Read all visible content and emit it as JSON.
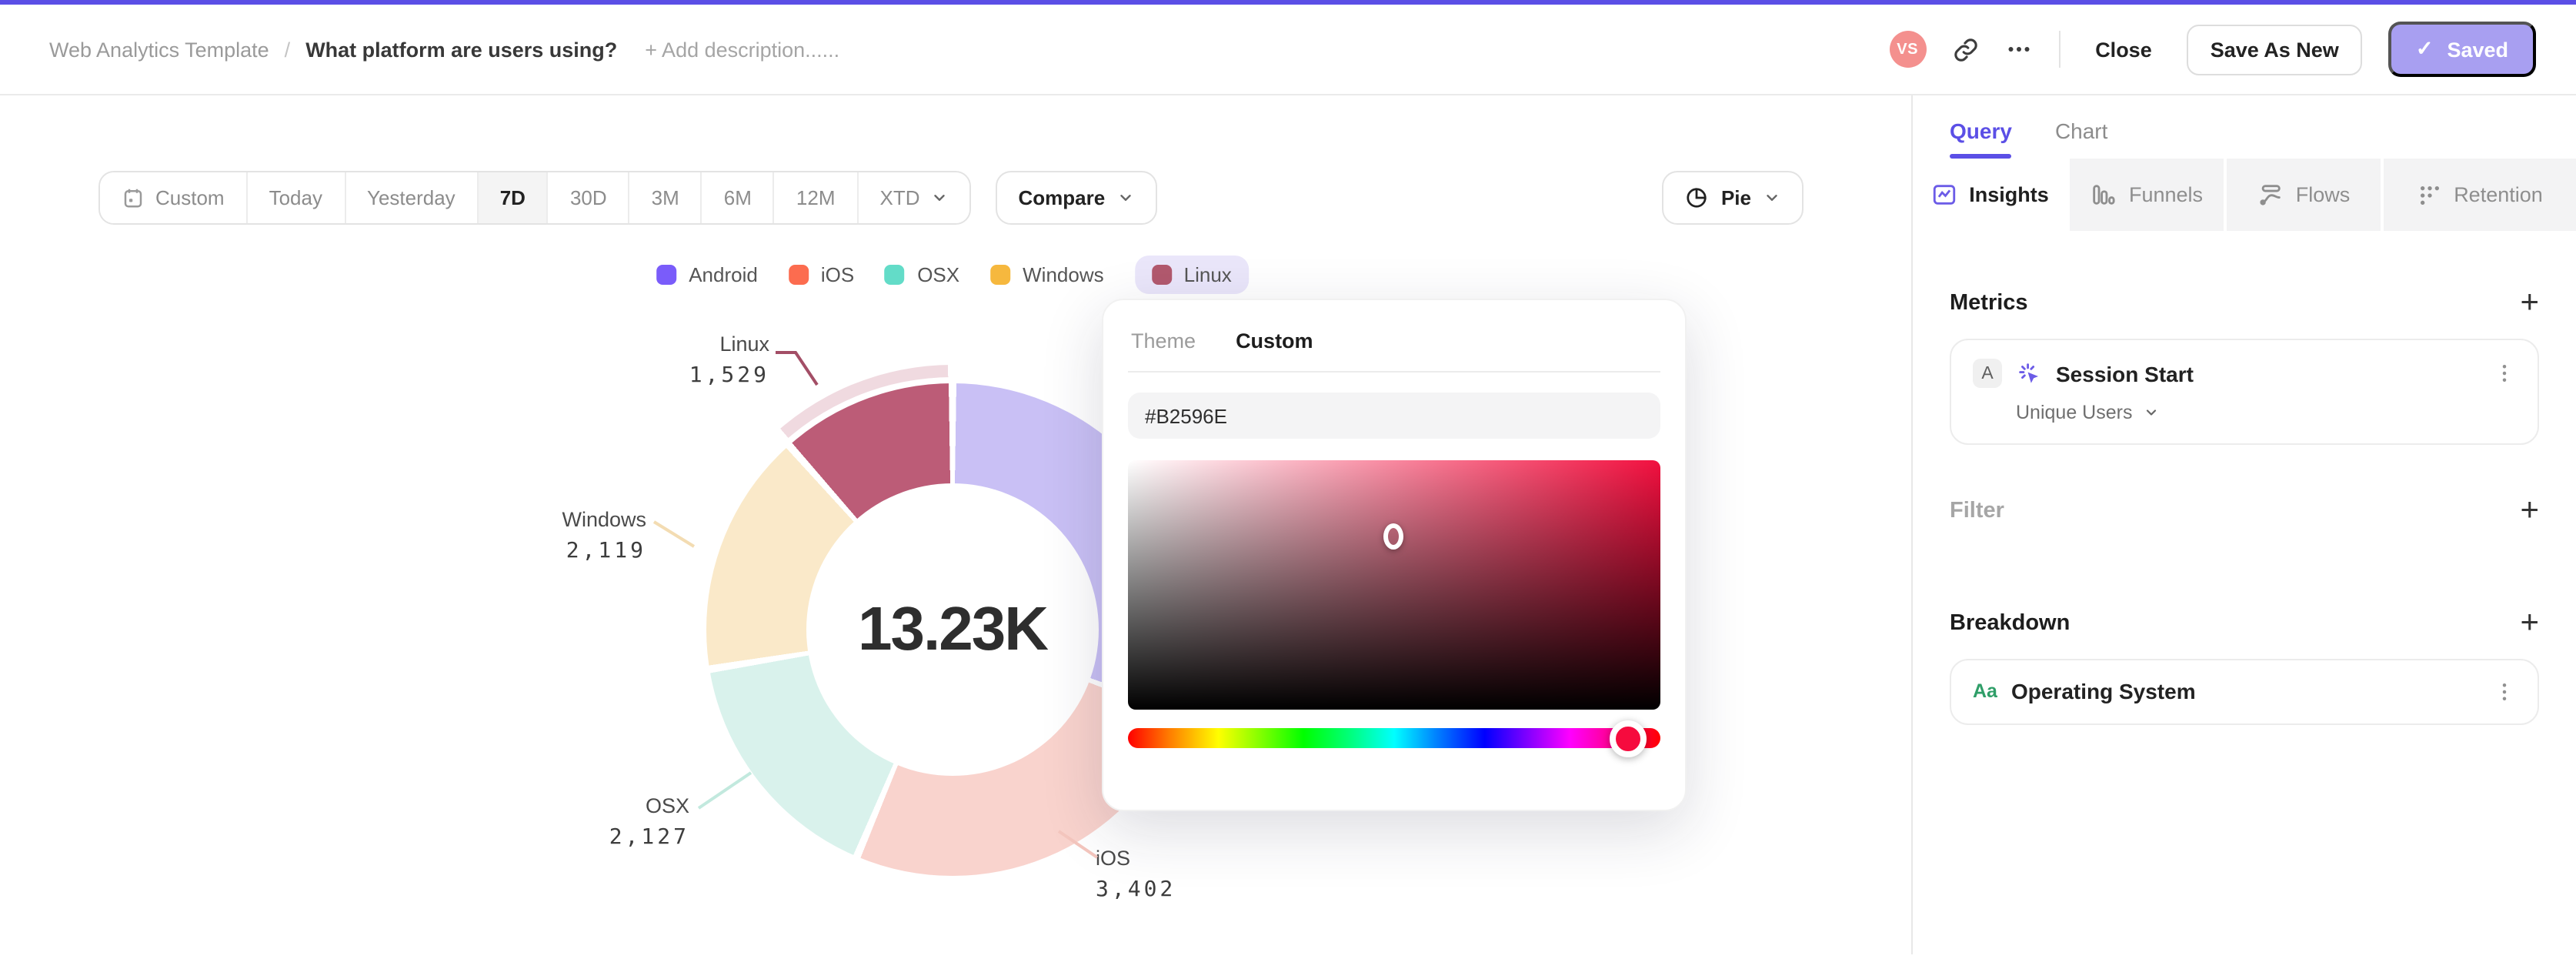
{
  "colors": {
    "accent": "#5B4FE6",
    "saved_button_bg": "#A89FF1",
    "avatar_bg": "#F4908E",
    "legend_pill_bg": "#EAE6FA",
    "picker_hue_color": "#F60B3E"
  },
  "header": {
    "breadcrumb_root": "Web Analytics Template",
    "breadcrumb_sep": "/",
    "title": "What platform are users using?",
    "add_description": "+ Add description......",
    "avatar_initials": "VS",
    "close_label": "Close",
    "save_as_new_label": "Save As New",
    "saved_label": "Saved",
    "saved_check": "✓"
  },
  "toolbar": {
    "date_ranges": [
      {
        "label": "Custom"
      },
      {
        "label": "Today"
      },
      {
        "label": "Yesterday"
      },
      {
        "label": "7D",
        "active": true
      },
      {
        "label": "30D"
      },
      {
        "label": "3M"
      },
      {
        "label": "6M"
      },
      {
        "label": "12M"
      },
      {
        "label": "XTD"
      }
    ],
    "compare_label": "Compare",
    "chart_type_label": "Pie"
  },
  "chart_data": {
    "type": "pie",
    "style": "donut",
    "title": "",
    "center_total": "13.23K",
    "total_value": 13230,
    "categories": [
      "Android",
      "iOS",
      "OSX",
      "Windows",
      "Linux"
    ],
    "values": [
      4053,
      3402,
      2127,
      2119,
      1529
    ],
    "value_labels": [
      null,
      "3,402",
      "2,127",
      "2,119",
      "1,529"
    ],
    "selected_category": "Linux",
    "selected_index": 4,
    "legend_position": "top",
    "legend_colors": [
      "#7A5CFA",
      "#FC6C4F",
      "#63DCC8",
      "#F6B83E",
      "#B2596E"
    ],
    "slice_colors": [
      "#C9C0F5",
      "#F9D3CD",
      "#D9F2EC",
      "#FAE9C9",
      "#BC5C77"
    ],
    "halo_color": "#F0DAE0"
  },
  "pie_labels": {
    "linux": {
      "name": "Linux",
      "value": "1,529"
    },
    "windows": {
      "name": "Windows",
      "value": "2,119"
    },
    "osx": {
      "name": "OSX",
      "value": "2,127"
    },
    "ios": {
      "name": "iOS",
      "value": "3,402"
    }
  },
  "color_picker": {
    "tabs": [
      {
        "label": "Theme"
      },
      {
        "label": "Custom",
        "active": true
      }
    ],
    "hex_value": "#B2596E"
  },
  "sidebar": {
    "tabs": [
      {
        "label": "Query",
        "active": true
      },
      {
        "label": "Chart"
      }
    ],
    "insight_tabs": [
      {
        "label": "Insights",
        "active": true
      },
      {
        "label": "Funnels"
      },
      {
        "label": "Flows"
      },
      {
        "label": "Retention"
      }
    ],
    "metrics": {
      "heading": "Metrics",
      "add_label": "+",
      "card": {
        "badge": "A",
        "name": "Session Start",
        "aggregation": "Unique Users"
      }
    },
    "filter": {
      "heading": "Filter",
      "add_label": "+"
    },
    "breakdown": {
      "heading": "Breakdown",
      "add_label": "+",
      "card": {
        "badge": "Aa",
        "name": "Operating System"
      }
    }
  }
}
